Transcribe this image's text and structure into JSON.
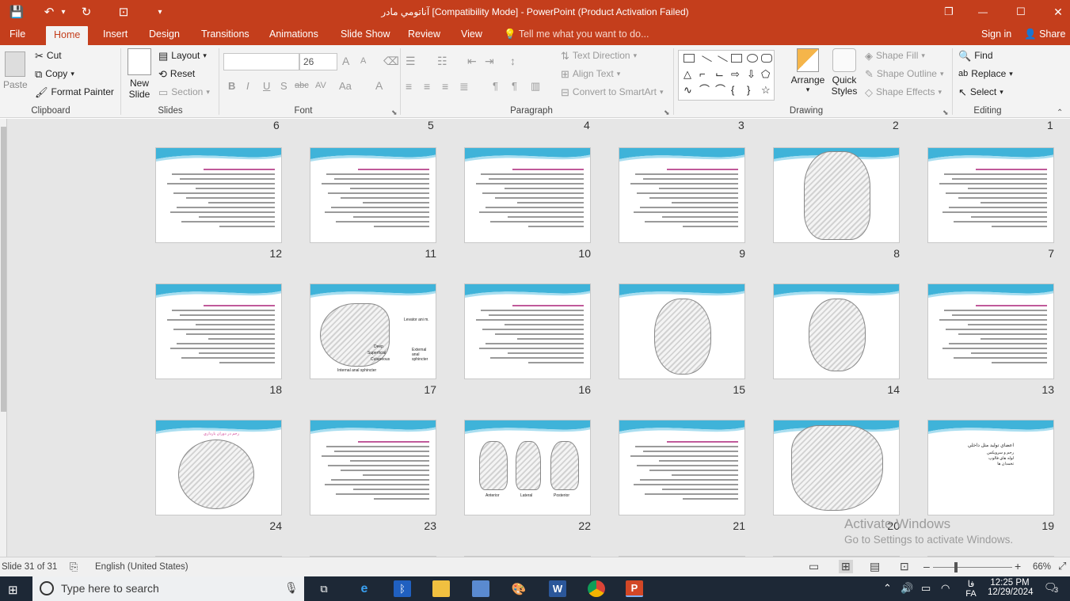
{
  "window": {
    "title": "آناتومي مادر [Compatibility Mode] - PowerPoint (Product Activation Failed)",
    "restore_glyph": "❐",
    "minimize_glyph": "—",
    "maximize_glyph": "☐",
    "close_glyph": "✕"
  },
  "quick_access": {
    "save_glyph": "💾",
    "undo_glyph": "↶",
    "undo_dropdown_glyph": "▾",
    "redo_glyph": "↻",
    "present_glyph": "⊡",
    "customize_glyph": "▾"
  },
  "tabs": [
    "File",
    "Home",
    "Insert",
    "Design",
    "Transitions",
    "Animations",
    "Slide Show",
    "Review",
    "View"
  ],
  "active_tab": "Home",
  "tell_me": "Tell me what you want to do...",
  "sign_in": "Sign in",
  "share": "Share",
  "ribbon": {
    "clipboard": {
      "label": "Clipboard",
      "paste": "Paste",
      "cut": "Cut",
      "copy": "Copy",
      "format_painter": "Format Painter"
    },
    "slides": {
      "label": "Slides",
      "new_slide_1": "New",
      "new_slide_2": "Slide",
      "layout": "Layout",
      "reset": "Reset",
      "section": "Section"
    },
    "font": {
      "label": "Font",
      "size": "26",
      "bold": "B",
      "italic": "I",
      "underline": "U",
      "shadow": "S",
      "strike": "abc",
      "spacing": "AV",
      "case": "Aa",
      "color": "A",
      "grow": "A",
      "shrink": "A"
    },
    "paragraph": {
      "label": "Paragraph",
      "text_direction": "Text Direction",
      "align_text": "Align Text",
      "smartart": "Convert to SmartArt"
    },
    "drawing": {
      "label": "Drawing",
      "arrange": "Arrange",
      "quick_styles_1": "Quick",
      "quick_styles_2": "Styles",
      "shape_fill": "Shape Fill",
      "shape_outline": "Shape Outline",
      "shape_effects": "Shape Effects"
    },
    "editing": {
      "label": "Editing",
      "find": "Find",
      "replace": "Replace",
      "select": "Select"
    }
  },
  "top_row_numbers": [
    "6",
    "5",
    "4",
    "3",
    "2",
    "1"
  ],
  "rows": [
    {
      "numbers": [
        "12",
        "11",
        "10",
        "9",
        "8",
        "7"
      ]
    },
    {
      "numbers": [
        "18",
        "17",
        "16",
        "15",
        "14",
        "13"
      ]
    },
    {
      "numbers": [
        "24",
        "23",
        "22",
        "21",
        "20",
        "19"
      ]
    }
  ],
  "slide_text": {
    "s17_a": "Levator ani m.",
    "s17_b": "Deep",
    "s17_c": "Superficial",
    "s17_d": "Cutaneous",
    "s17_e": "External anal sphincter",
    "s17_f": "Internal anal sphincter",
    "s22_a": "Anterior",
    "s22_b": "Lateral",
    "s22_c": "Posterior",
    "s24_title": "رحم در دوران بارداري",
    "s19_title": "اعضاي توليد مثل داخلي",
    "s19_b1": "رحم و سرويكس",
    "s19_b2": "لوله هاي فالوپ",
    "s19_b3": "تخمدان ها"
  },
  "activation": {
    "line1": "Activate Windows",
    "line2": "Go to Settings to activate Windows."
  },
  "status": {
    "slide_info": "Slide 31 of 31",
    "language": "English (United States)",
    "zoom": "66%",
    "zoom_minus": "–",
    "zoom_plus": "+"
  },
  "taskbar": {
    "search_placeholder": "Type here to search",
    "time": "12:25 PM",
    "date": "12/29/2024",
    "lang": "FA",
    "lang_native": "فا",
    "notifications": "3",
    "word_label": "W",
    "ppt_label": "P"
  },
  "colors": {
    "accent": "#c43e1c",
    "slide_wave": "#3fb3d9",
    "taskbar": "#1d2836"
  }
}
